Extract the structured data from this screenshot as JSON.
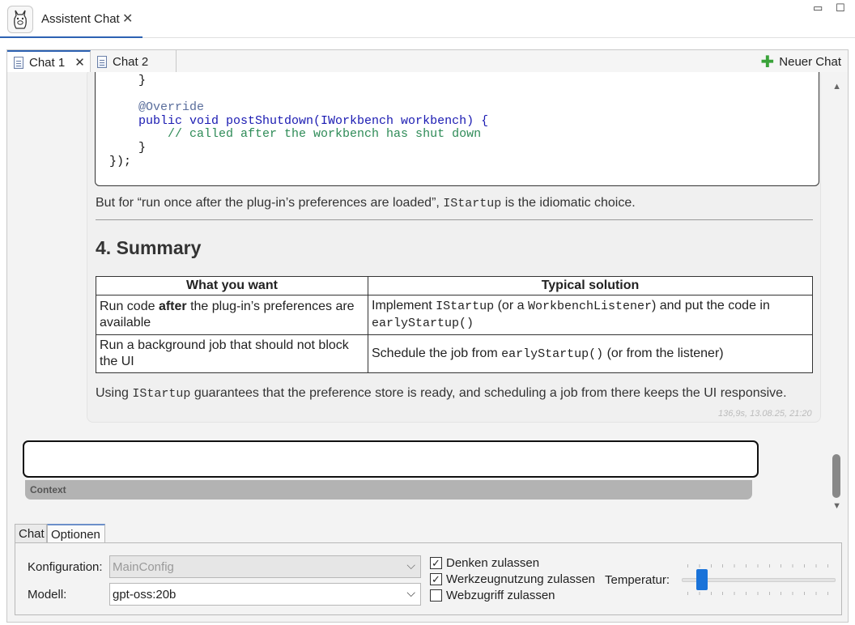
{
  "view_tab": {
    "title": "Assistent Chat",
    "logo_icon": "llama-icon",
    "close_glyph": "✕"
  },
  "window_controls": {
    "minimize": "▭",
    "maximize": "☐"
  },
  "chat_tabs": {
    "tabs": [
      {
        "label": "Chat 1",
        "active": true,
        "closable": true
      },
      {
        "label": "Chat 2",
        "active": false,
        "closable": false
      }
    ],
    "close_glyph": "✕",
    "new_chat_label": "Neuer Chat"
  },
  "message": {
    "code_lines": [
      "    }",
      "",
      "    @Override",
      "    public void postShutdown(IWorkbench workbench) {",
      "        // called after the workbench has shut down",
      "    }",
      "});"
    ],
    "para1_a": "But for “run once after the plug-in’s preferences are loaded”, ",
    "para1_code": "IStartup",
    "para1_b": " is the idiomatic choice.",
    "heading": "4. Summary",
    "table": {
      "headers": [
        "What you want",
        "Typical solution"
      ],
      "row1": {
        "c1_a": "Run code ",
        "c1_bold": "after",
        "c1_b": " the plug-in’s preferences are available",
        "c2_a": "Implement ",
        "c2_code1": "IStartup",
        "c2_b": " (or a ",
        "c2_code2": "WorkbenchListener",
        "c2_c": ") and put the code in ",
        "c2_code3": "earlyStartup()"
      },
      "row2": {
        "c1": "Run a background job that should not block the UI",
        "c2_a": "Schedule the job from ",
        "c2_code": "earlyStartup()",
        "c2_b": " (or from the listener)"
      }
    },
    "para2_a": "Using ",
    "para2_code": "IStartup",
    "para2_b": " guarantees that the preference store is ready, and scheduling a job from there keeps the UI responsive.",
    "timestamp": "136,9s, 13.08.25, 21:20"
  },
  "input": {
    "value": "",
    "context_label": "Context"
  },
  "bottom": {
    "tabs": [
      "Chat",
      "Optionen"
    ],
    "active_tab": "Optionen",
    "config_label": "Konfiguration:",
    "config_value": "MainConfig",
    "model_label": "Modell:",
    "model_value": "gpt-oss:20b",
    "checkboxes": [
      {
        "label": "Denken zulassen",
        "checked": true
      },
      {
        "label": "Werkzeugnutzung zulassen",
        "checked": true
      },
      {
        "label": "Webzugriff zulassen",
        "checked": false
      }
    ],
    "temperature_label": "Temperatur:",
    "temperature_fraction": 0.1
  }
}
